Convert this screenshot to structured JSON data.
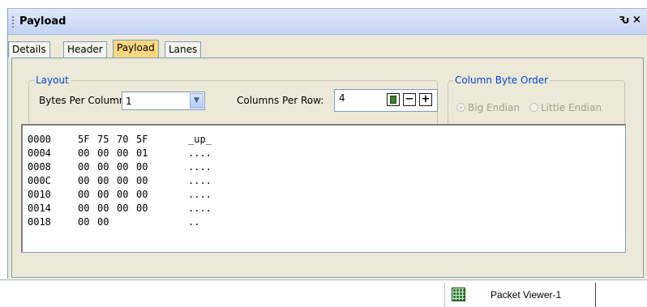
{
  "panel": {
    "title": "Payload",
    "pin_glyph": "Ԅ",
    "close_glyph": "×"
  },
  "tabs": [
    {
      "label": "Details",
      "active": false
    },
    {
      "label": "Header",
      "active": false
    },
    {
      "label": "Payload",
      "active": true
    },
    {
      "label": "Lanes",
      "active": false
    }
  ],
  "layout": {
    "legend": "Layout",
    "bytes_per_column_label": "Bytes Per Column:",
    "bytes_per_column_value": "1",
    "columns_per_row_label": "Columns Per Row:",
    "columns_per_row_value": "4",
    "minus_glyph": "−",
    "plus_glyph": "+",
    "calc_icon": "calculator-icon"
  },
  "byte_order": {
    "legend": "Column Byte Order",
    "big_endian": "Big Endian",
    "little_endian": "Little Endian",
    "selected": "big_endian"
  },
  "hex_rows": [
    {
      "offset": "0000",
      "bytes": [
        "5F",
        "75",
        "70",
        "5F"
      ],
      "ascii": "_up_"
    },
    {
      "offset": "0004",
      "bytes": [
        "00",
        "00",
        "00",
        "01"
      ],
      "ascii": "...."
    },
    {
      "offset": "0008",
      "bytes": [
        "00",
        "00",
        "00",
        "00"
      ],
      "ascii": "...."
    },
    {
      "offset": "000C",
      "bytes": [
        "00",
        "00",
        "00",
        "00"
      ],
      "ascii": "...."
    },
    {
      "offset": "0010",
      "bytes": [
        "00",
        "00",
        "00",
        "00"
      ],
      "ascii": "...."
    },
    {
      "offset": "0014",
      "bytes": [
        "00",
        "00",
        "00",
        "00"
      ],
      "ascii": "...."
    },
    {
      "offset": "0018",
      "bytes": [
        "00",
        "00"
      ],
      "ascii": ".."
    }
  ],
  "document_tab": {
    "label": "Packet Viewer-1",
    "icon": "grid-icon"
  }
}
